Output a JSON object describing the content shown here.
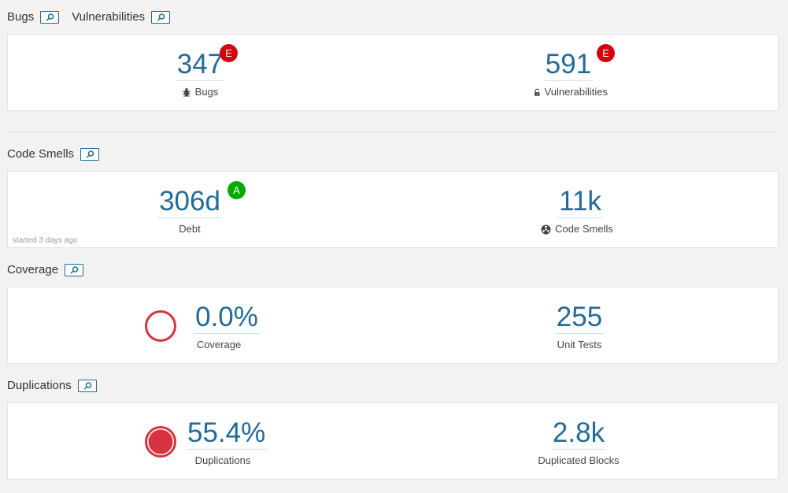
{
  "colors": {
    "link": "#236a97",
    "rating_e": "#d4020d",
    "rating_a": "#00aa00",
    "danger": "#d4333f"
  },
  "bugs_vulns": {
    "bugs_title": "Bugs",
    "vulns_title": "Vulnerabilities",
    "bugs": {
      "value": "347",
      "rating": "E",
      "label": "Bugs",
      "icon": "bug-icon"
    },
    "vulnerabilities": {
      "value": "591",
      "rating": "E",
      "label": "Vulnerabilities",
      "icon": "lock-open-icon"
    }
  },
  "code_smells": {
    "title": "Code Smells",
    "debt": {
      "value": "306d",
      "rating": "A",
      "label": "Debt"
    },
    "smells": {
      "value": "11k",
      "label": "Code Smells",
      "icon": "code-smell-icon"
    },
    "note": "started 3 days ago"
  },
  "coverage": {
    "title": "Coverage",
    "coverage": {
      "value": "0.0%",
      "label": "Coverage",
      "percent": 0.0
    },
    "tests": {
      "value": "255",
      "label": "Unit Tests"
    }
  },
  "duplications": {
    "title": "Duplications",
    "duplications": {
      "value": "55.4%",
      "label": "Duplications",
      "percent": 55.4
    },
    "blocks": {
      "value": "2.8k",
      "label": "Duplicated Blocks"
    }
  }
}
